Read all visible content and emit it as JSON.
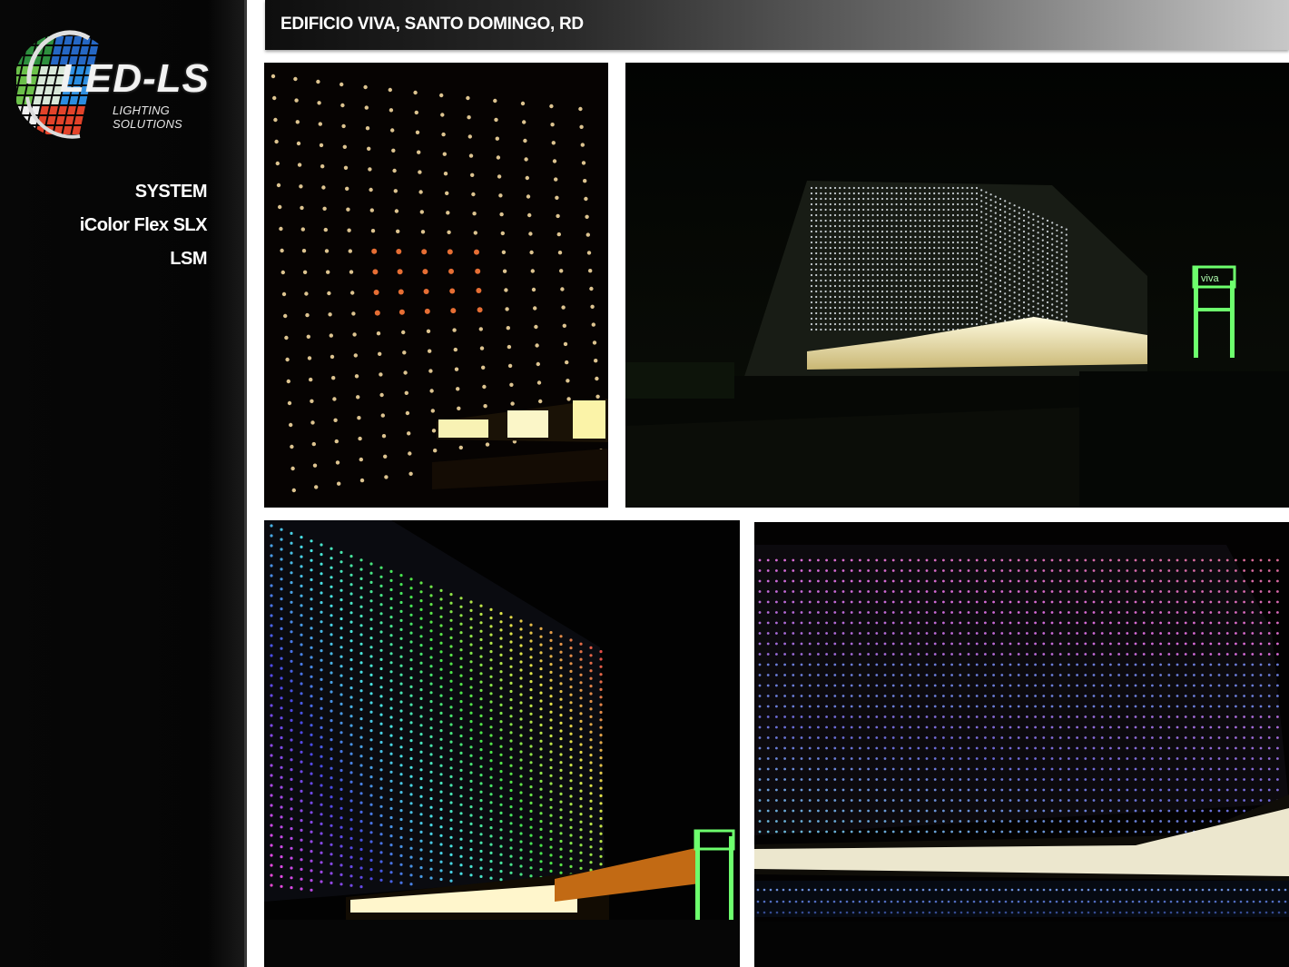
{
  "brand": {
    "logo_main": "LED-LS",
    "logo_tagline": "LIGHTING SOLUTIONS"
  },
  "header": {
    "title": "EDIFICIO VIVA, SANTO DOMINGO, RD"
  },
  "sidebar": {
    "items": [
      {
        "label": "SYSTEM"
      },
      {
        "label": "iColor Flex SLX"
      },
      {
        "label": "LSM"
      }
    ]
  },
  "photos": {
    "sign_text": "viva"
  },
  "colors": {
    "sidebar_bg": "#050505",
    "page_bg": "#ffffff",
    "header_dark": "#0e0e0e",
    "header_light": "#c7c7c7",
    "led_warm": "#f5d9a0",
    "led_white": "#e8eef5",
    "sign_green": "#6dff6d"
  }
}
